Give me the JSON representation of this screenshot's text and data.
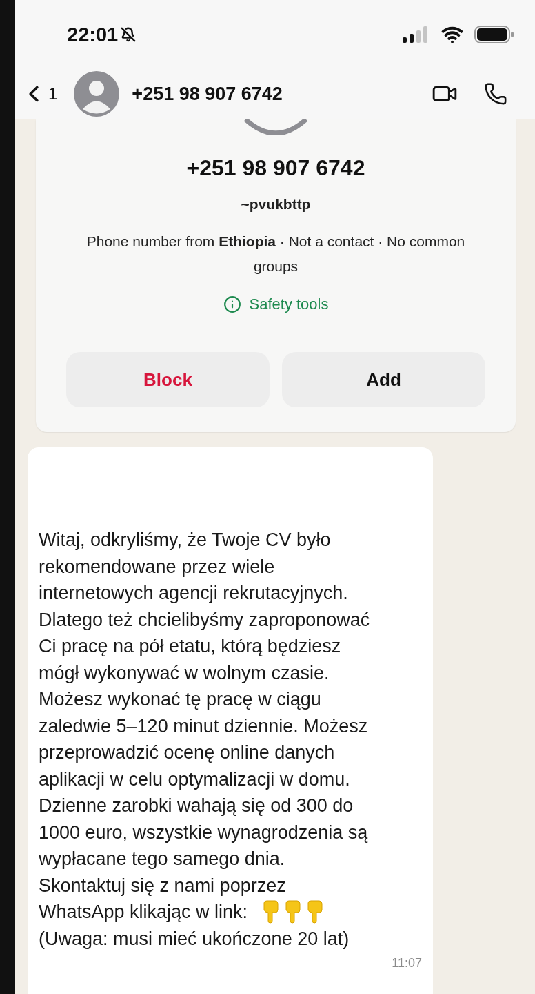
{
  "status_bar": {
    "time": "22:01",
    "silent": true
  },
  "header": {
    "back_count": "1",
    "title": "+251 98 907 6742"
  },
  "contact_card": {
    "phone": "+251 98 907 6742",
    "username": "~pvukbttp",
    "info": "Phone number from **Ethiopia** · Not a contact · No common groups",
    "safety_link": "Safety tools",
    "buttons": [
      {
        "label": "Block",
        "kind": "danger"
      },
      {
        "label": "Add",
        "kind": "normal"
      }
    ]
  },
  "message": {
    "lines": [
      "Witaj, odkryliśmy, że Twoje CV było",
      "rekomendowane przez wiele",
      "internetowych agencji rekrutacyjnych.",
      "Dlatego też chcielibyśmy zaproponować",
      "Ci pracę na pół etatu, którą będziesz",
      "mógł wykonywać w wolnym czasie.",
      "Możesz wykonać tę pracę w ciągu",
      "zaledwie 5–120 minut dziennie. Możesz",
      "przeprowadzić ocenę online danych",
      "aplikacji w celu optymalizacji w domu.",
      "Dzienne zarobki wahają się od 300 do",
      "1000 euro, wszystkie wynagrodzenia są",
      "wypłacane tego samego dnia.",
      "Skontaktuj się z nami poprzez"
    ],
    "link_line": "WhatsApp klikając w link:",
    "note": "(Uwaga: musi mieć ukończone 20 lat)",
    "time": "11:07"
  }
}
